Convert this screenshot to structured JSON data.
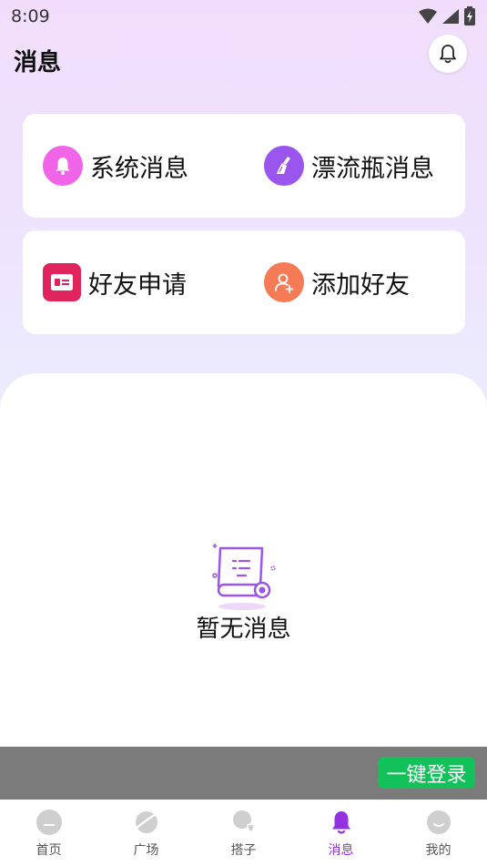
{
  "status_bar": {
    "time": "8:09"
  },
  "header": {
    "title": "消息"
  },
  "cards": [
    {
      "items": [
        {
          "label": "系统消息",
          "icon": "bell-icon",
          "color": "#f064e8"
        },
        {
          "label": "漂流瓶消息",
          "icon": "broom-icon",
          "color": "#9a55ee"
        }
      ]
    },
    {
      "items": [
        {
          "label": "好友申请",
          "icon": "id-card-icon",
          "color": "#e0245e"
        },
        {
          "label": "添加好友",
          "icon": "add-user-icon",
          "color": "#f47b55"
        }
      ]
    }
  ],
  "empty_state": {
    "text": "暂无消息",
    "icon": "scroll-icon"
  },
  "login": {
    "label": "一键登录",
    "color": "#12c15a"
  },
  "tabs": [
    {
      "label": "首页",
      "icon": "home-icon"
    },
    {
      "label": "广场",
      "icon": "planet-icon"
    },
    {
      "label": "搭子",
      "icon": "friend-icon"
    },
    {
      "label": "消息",
      "icon": "bell-icon",
      "active": true
    },
    {
      "label": "我的",
      "icon": "profile-icon"
    }
  ],
  "colors": {
    "accent": "#9431e0",
    "inactive_icon": "#cfcfcf"
  }
}
